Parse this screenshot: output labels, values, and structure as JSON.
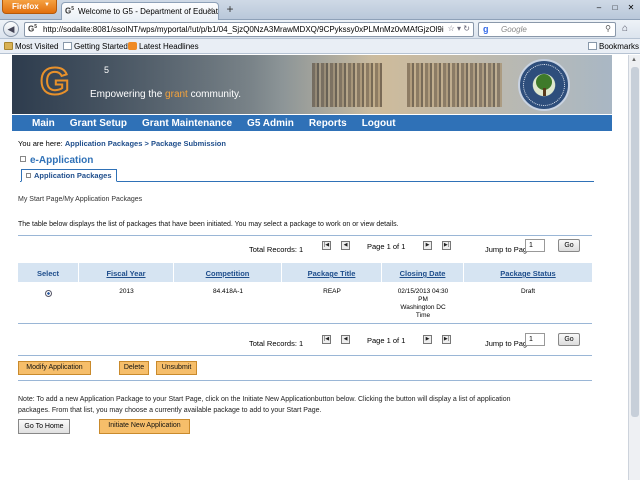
{
  "browser": {
    "menu_button": "Firefox",
    "tab_title": "Welcome to G5 - Department of Educati...",
    "url": "http://sodalite:8081/ssoINT/wps/myportal/!ut/p/b1/04_SjzQ0NzA3MrawMDXQ/9CPykssy0xPLMnMz0vMAfGjzOl9i",
    "search_placeholder": "Google",
    "bookmarks": [
      "Most Visited",
      "Getting Started",
      "Latest Headlines"
    ],
    "bookmarks_menu": "Bookmarks"
  },
  "banner": {
    "logo_sup": "5",
    "tagline_before": "Empowering the ",
    "tagline_highlight": "grant",
    "tagline_after": " community."
  },
  "menu": [
    "Main",
    "Grant Setup",
    "Grant Maintenance",
    "G5 Admin",
    "Reports",
    "Logout"
  ],
  "breadcrumb": {
    "prefix": "You are here: ",
    "link1": "Application Packages",
    "separator": " > ",
    "link2": "Package Submission"
  },
  "section_title": "e-Application",
  "subtab": "Application Packages",
  "path_text": "My Start Page/My Application Packages",
  "description": "The table below displays the list of packages that have been initiated. You may select a package to work on or view details.",
  "pager": {
    "total": "Total Records: 1",
    "page_of": "Page 1 of 1",
    "jump_label": "Jump to Page",
    "jump_value": "1",
    "go": "Go"
  },
  "table": {
    "columns": [
      "Select",
      "Fiscal Year",
      "Competition",
      "Package Title",
      "Closing Date",
      "Package Status"
    ],
    "rows": [
      {
        "fiscal_year": "2013",
        "competition": "84.418A-1",
        "package_title": "REAP",
        "closing_date_1": "02/15/2013 04:30",
        "closing_date_2": "PM",
        "closing_date_3": "Washington DC",
        "closing_date_4": "Time",
        "status": "Draft"
      }
    ]
  },
  "actions": {
    "modify": "Modify Application",
    "delete": "Delete",
    "unsubmit": "Unsubmit"
  },
  "note_line1": "Note: To add a new Application Package to your Start Page, click on the Initiate New Applicationbutton below. Clicking the button will display a list of application",
  "note_line2": "packages. From that list, you may choose a currently available package to add to your Start Page.",
  "bottom": {
    "home": "Go To Home",
    "initiate": "Initiate New Application"
  }
}
